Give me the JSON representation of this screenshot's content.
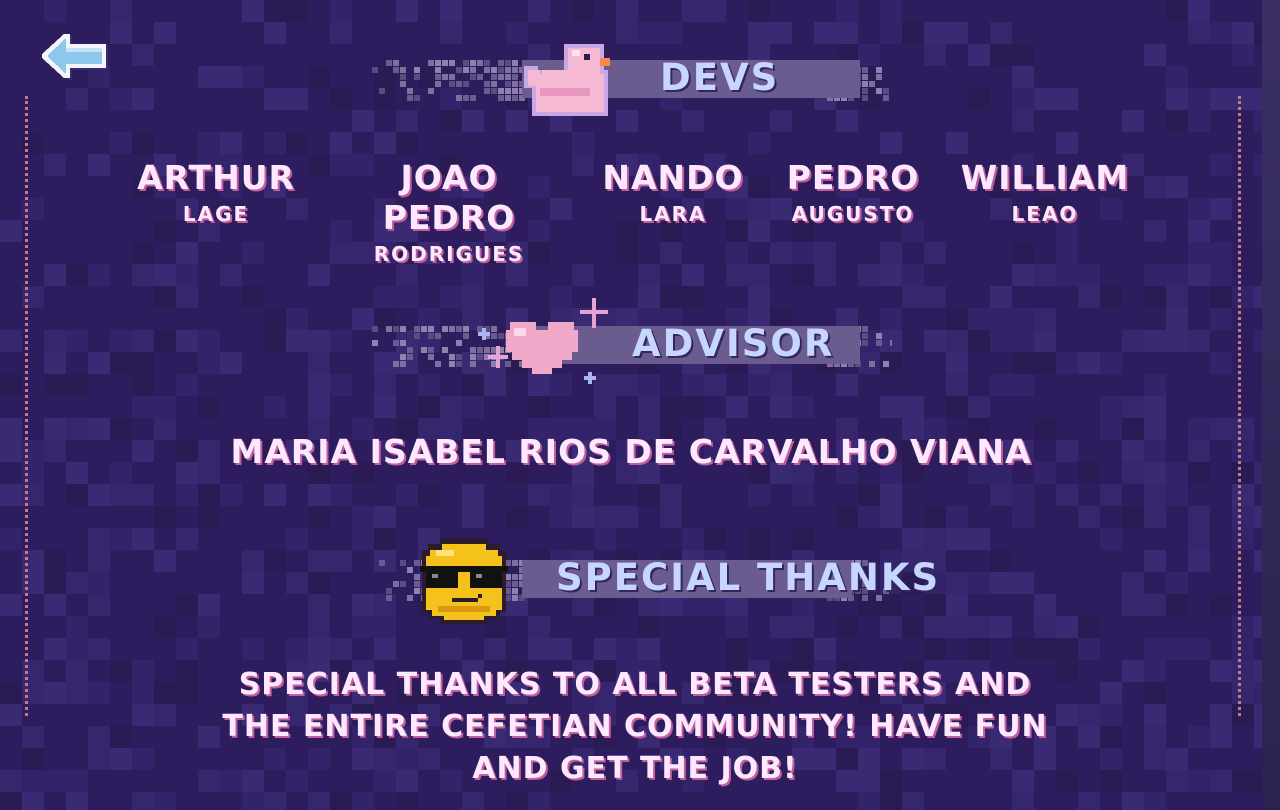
{
  "screen": {
    "colors": {
      "background": "#2e1d5e",
      "banner_bar": "#6b5c8f",
      "banner_text": "#c7d6ff",
      "name_text": "#fde8ff",
      "name_shadow": "#c25f9a",
      "side_border": "#c77a86"
    }
  },
  "back_button": {
    "icon": "arrow-left-icon"
  },
  "sections": {
    "devs": {
      "title": "DEVS",
      "icon": "rubber-duck-icon",
      "members": [
        {
          "first": "ARTHUR",
          "last": "LAGE"
        },
        {
          "first": "JOAO PEDRO",
          "last": "RODRIGUES"
        },
        {
          "first": "NANDO",
          "last": "LARA"
        },
        {
          "first": "PEDRO",
          "last": "AUGUSTO"
        },
        {
          "first": "WILLIAM",
          "last": "LEAO"
        }
      ]
    },
    "advisor": {
      "title": "ADVISOR",
      "icon": "sparkling-heart-icon",
      "name": "MARIA ISABEL RIOS DE CARVALHO VIANA"
    },
    "special_thanks": {
      "title": "SPECIAL THANKS",
      "icon": "sunglasses-smiley-icon",
      "message": "SPECIAL THANKS TO ALL BETA TESTERS AND THE ENTIRE CEFETIAN COMMUNITY! HAVE FUN AND GET THE JOB!"
    }
  }
}
